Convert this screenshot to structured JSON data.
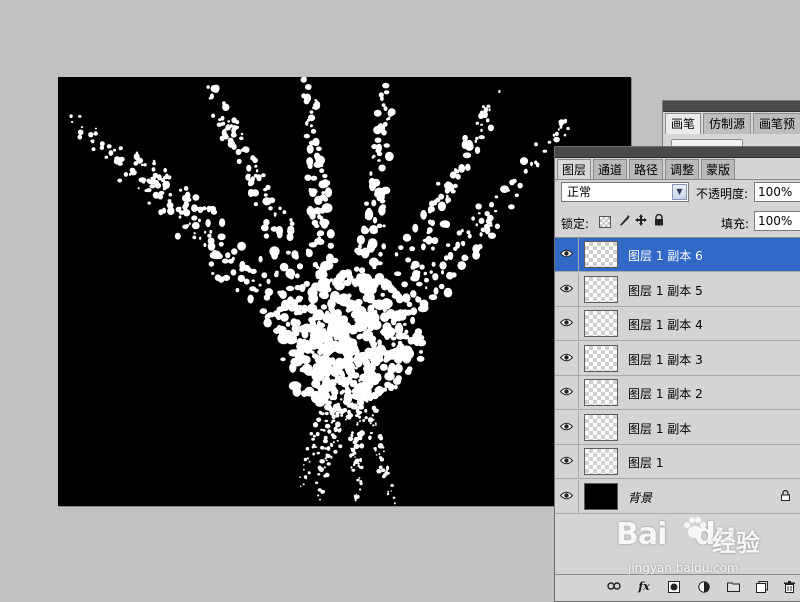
{
  "brush_panel": {
    "tabs": [
      {
        "label": "画笔",
        "active": true
      },
      {
        "label": "仿制源",
        "active": false
      },
      {
        "label": "画笔预",
        "active": false
      }
    ]
  },
  "layers_panel": {
    "tabs": [
      {
        "label": "图层",
        "active": true
      },
      {
        "label": "通道",
        "active": false
      },
      {
        "label": "路径",
        "active": false
      },
      {
        "label": "调整",
        "active": false
      },
      {
        "label": "蒙版",
        "active": false
      }
    ],
    "blend_mode": "正常",
    "opacity_label": "不透明度:",
    "opacity_value": "100%",
    "lock_label": "锁定:",
    "fill_label": "填充:",
    "fill_value": "100%",
    "layers": [
      {
        "name": "图层 1 副本 6",
        "selected": true,
        "visible": true,
        "thumb": "transparent"
      },
      {
        "name": "图层 1 副本 5",
        "selected": false,
        "visible": true,
        "thumb": "transparent"
      },
      {
        "name": "图层 1 副本 4",
        "selected": false,
        "visible": true,
        "thumb": "transparent"
      },
      {
        "name": "图层 1 副本 3",
        "selected": false,
        "visible": true,
        "thumb": "transparent"
      },
      {
        "name": "图层 1 副本 2",
        "selected": false,
        "visible": true,
        "thumb": "transparent"
      },
      {
        "name": "图层 1 副本",
        "selected": false,
        "visible": true,
        "thumb": "transparent"
      },
      {
        "name": "图层 1",
        "selected": false,
        "visible": true,
        "thumb": "transparent"
      },
      {
        "name": "背景",
        "selected": false,
        "visible": true,
        "thumb": "black",
        "locked": true
      }
    ]
  },
  "watermark": {
    "logo": "Bai",
    "logo_suffix": "du",
    "brand": "经验",
    "url": "jingyan.baidu.com"
  },
  "colors": {
    "selection": "#3169c6",
    "panel_bg": "#d4d4d4",
    "workspace_bg": "#c0c0c0"
  }
}
